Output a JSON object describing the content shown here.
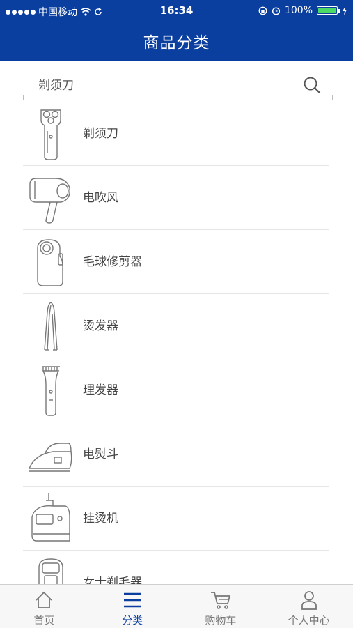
{
  "status_bar": {
    "carrier": "中国移动",
    "time": "16:34",
    "battery": "100%",
    "battery_level": 1.0
  },
  "header": {
    "title": "商品分类"
  },
  "search": {
    "value": "剃须刀"
  },
  "categories": [
    {
      "label": "剃须刀",
      "icon": "shaver-icon"
    },
    {
      "label": "电吹风",
      "icon": "hair-dryer-icon"
    },
    {
      "label": "毛球修剪器",
      "icon": "lint-remover-icon"
    },
    {
      "label": "烫发器",
      "icon": "hair-straightener-icon"
    },
    {
      "label": "理发器",
      "icon": "hair-clipper-icon"
    },
    {
      "label": "电熨斗",
      "icon": "iron-icon"
    },
    {
      "label": "挂烫机",
      "icon": "garment-steamer-icon"
    },
    {
      "label": "女士剃毛器",
      "icon": "lady-shaver-icon"
    }
  ],
  "tab_bar": {
    "tabs": [
      {
        "label": "首页",
        "icon": "home-icon"
      },
      {
        "label": "分类",
        "icon": "menu-icon"
      },
      {
        "label": "购物车",
        "icon": "cart-icon"
      },
      {
        "label": "个人中心",
        "icon": "user-icon"
      }
    ],
    "active_index": 1
  },
  "colors": {
    "brand": "#0a3fa0",
    "battery": "#4cd964",
    "tab_inactive": "#777777"
  }
}
